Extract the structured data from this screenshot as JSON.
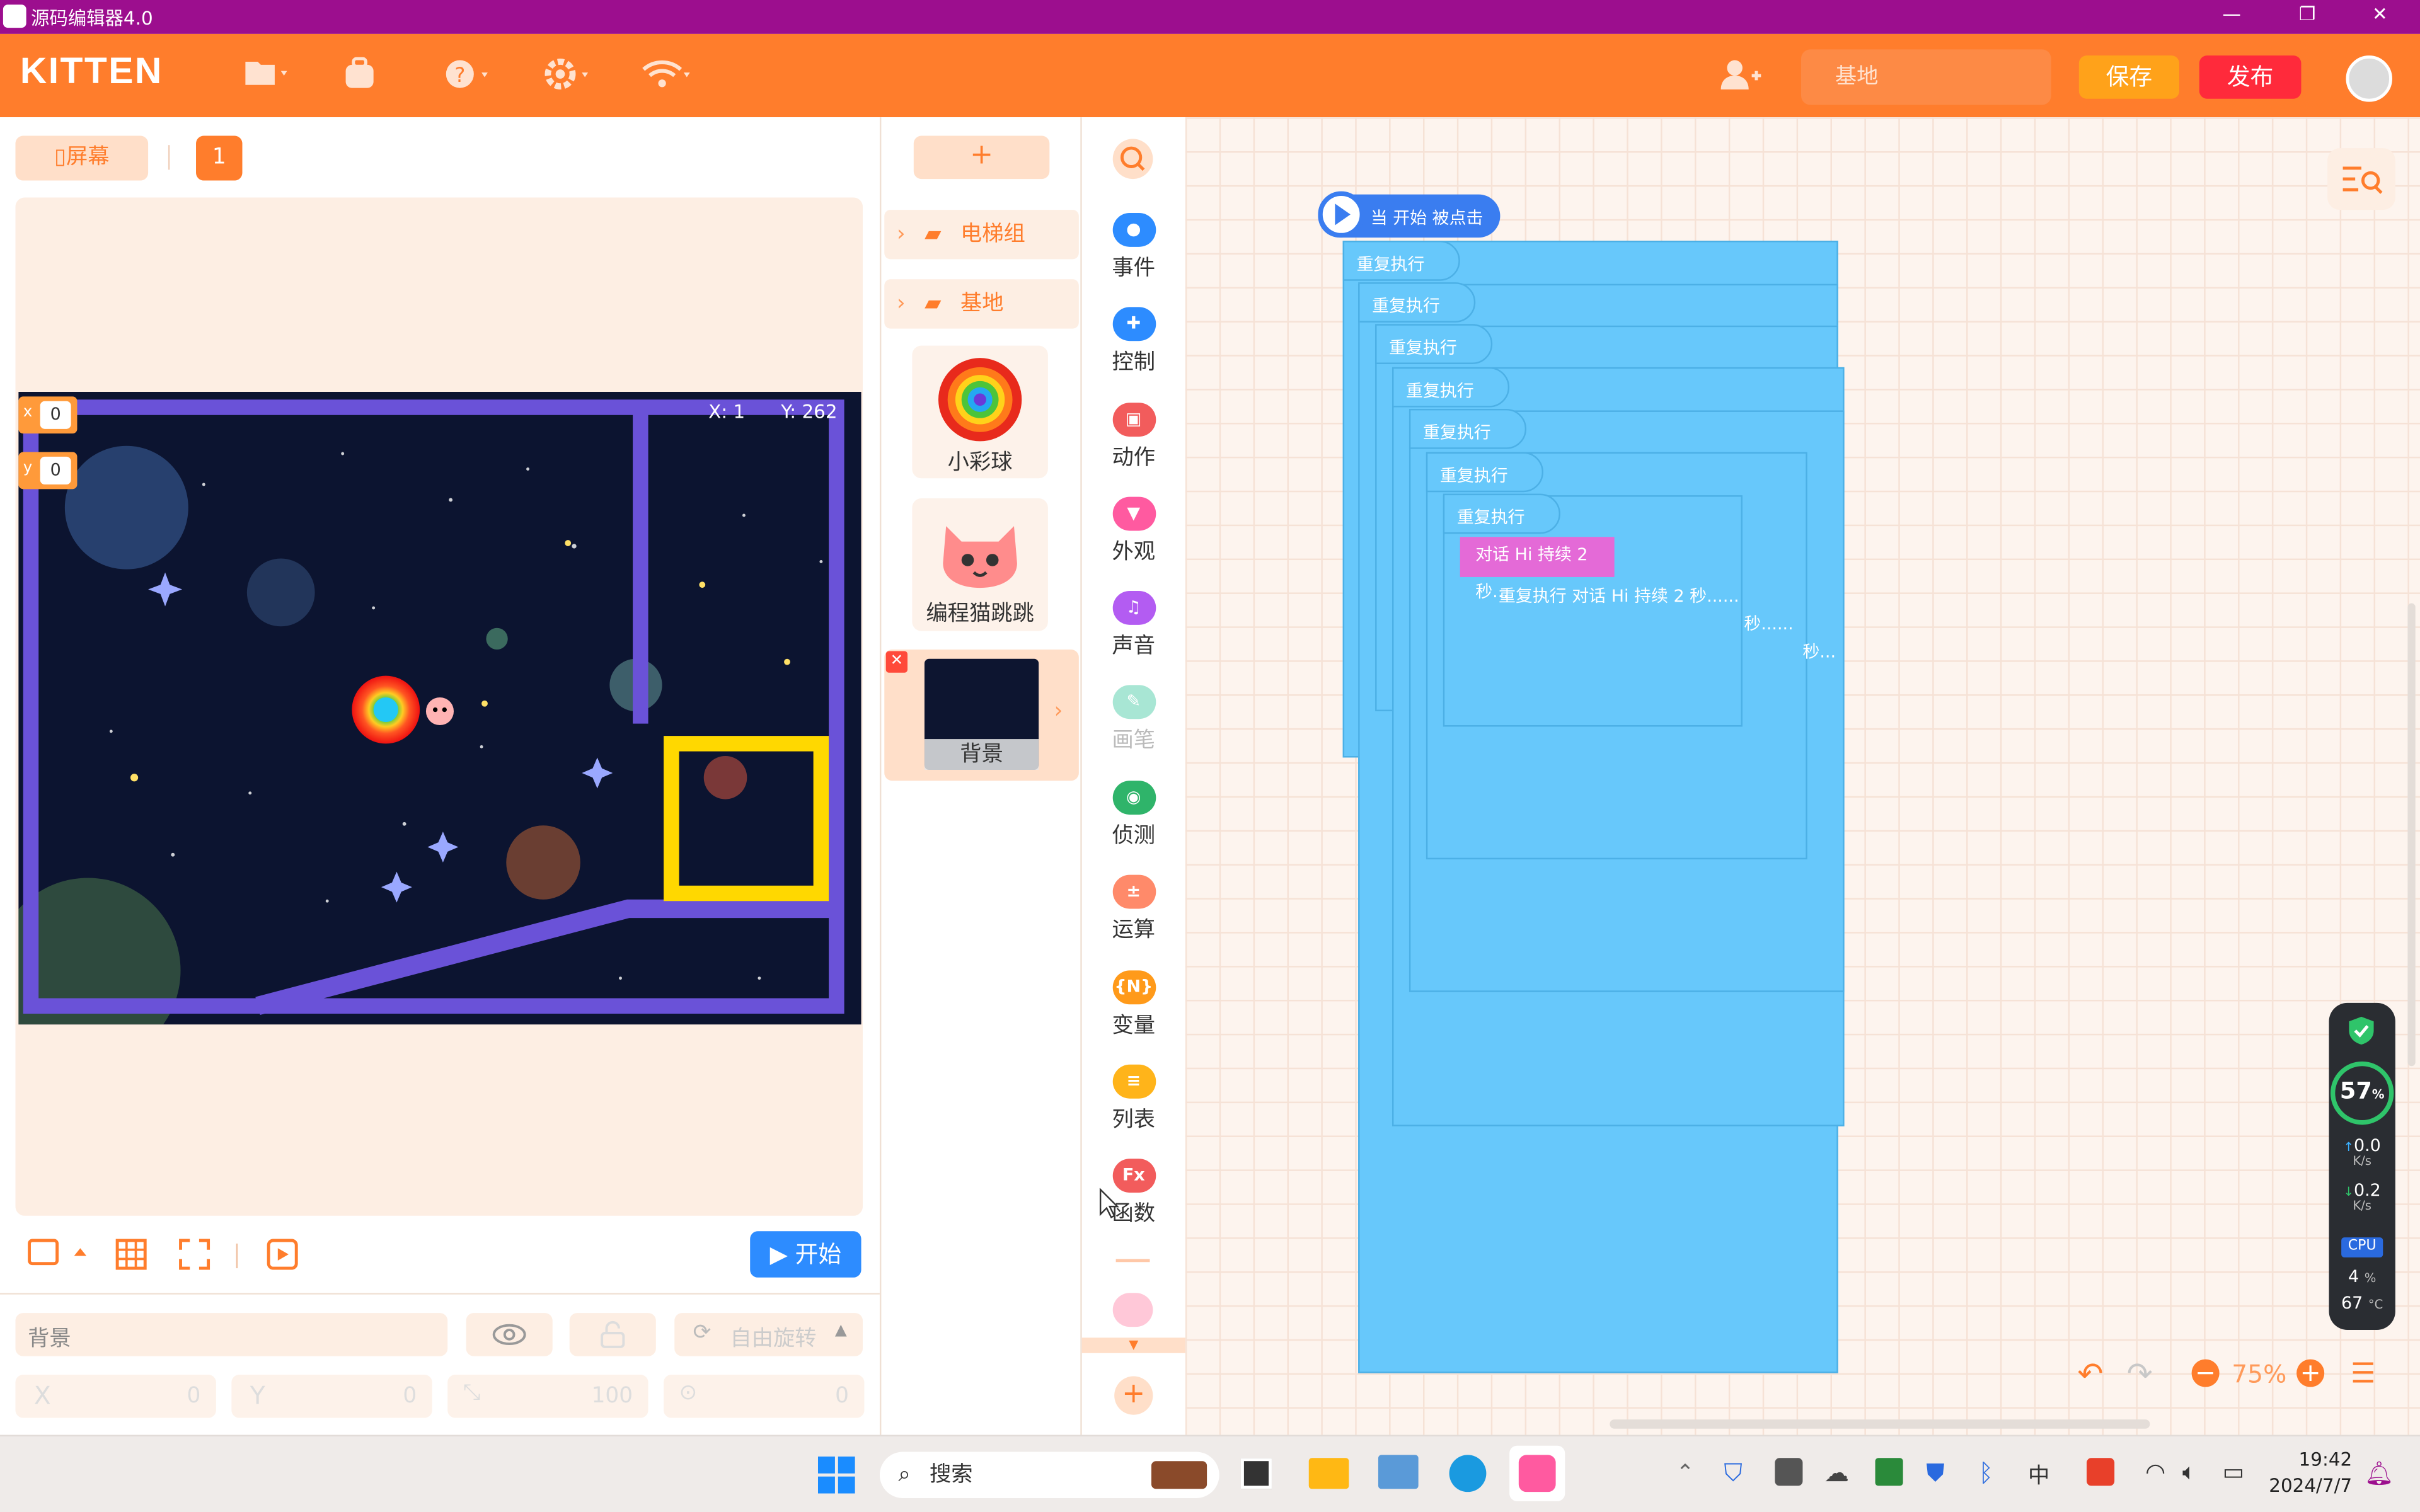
{
  "window": {
    "title": "源码编辑器4.0",
    "minimize": "—",
    "restore": "❐",
    "close": "✕"
  },
  "header": {
    "logo": "KITTEN",
    "search_value": "基地",
    "save_label": "保存",
    "publish_label": "发布",
    "icons": [
      "folder-icon",
      "backpack-icon",
      "help-icon",
      "settings-icon",
      "wifi-icon",
      "add-user-icon",
      "avatar"
    ]
  },
  "stage": {
    "tab_screen": "屏幕",
    "tab_number": "1",
    "x_label": "x",
    "x_value": "0",
    "y_label": "y",
    "y_value": "0",
    "mouse_x": "X: 1",
    "mouse_y": "Y: 262",
    "start_label": "开始",
    "selected_name": "背景",
    "rotation_label": "自由旋转",
    "field_x_label": "X",
    "field_x": "0",
    "field_y_label": "Y",
    "field_y": "0",
    "field_size": "100",
    "field_dir": "0"
  },
  "sprites": {
    "add_label": "+",
    "groups": [
      {
        "label": "电梯组"
      },
      {
        "label": "基地"
      }
    ],
    "items": [
      {
        "name": "小彩球"
      },
      {
        "name": "编程猫跳跳"
      },
      {
        "name": "背景"
      }
    ]
  },
  "categories": [
    {
      "label": "事件",
      "color": "#2d8cff",
      "icon": "event-icon"
    },
    {
      "label": "控制",
      "color": "#2d8cff",
      "icon": "control-icon"
    },
    {
      "label": "动作",
      "color": "#f25c5c",
      "icon": "motion-icon"
    },
    {
      "label": "外观",
      "color": "#ff5aa0",
      "icon": "looks-icon"
    },
    {
      "label": "声音",
      "color": "#b35cf2",
      "icon": "sound-icon"
    },
    {
      "label": "画笔",
      "color": "#a8e6d4",
      "icon": "pen-icon"
    },
    {
      "label": "侦测",
      "color": "#2fb46a",
      "icon": "sensing-icon"
    },
    {
      "label": "运算",
      "color": "#ff8a6a",
      "icon": "operator-icon"
    },
    {
      "label": "变量",
      "color": "#ff9a1a",
      "icon": "variable-icon"
    },
    {
      "label": "列表",
      "color": "#ffb41a",
      "icon": "list-icon"
    },
    {
      "label": "函数",
      "color": "#f25c5c",
      "icon": "function-icon"
    }
  ],
  "code": {
    "hat": "当 开始 被点击",
    "repeat_label": "重复执行",
    "speech": "对话 Hi 持续 2 秒...",
    "overlap_line": "重复执行 对话 Hi 持续 2 秒......",
    "frag1": "秒......",
    "frag2": "秒..."
  },
  "workspace": {
    "zoom": "75%"
  },
  "taskbar": {
    "search_placeholder": "搜索",
    "time": "19:42",
    "date": "2024/7/7",
    "ime": "中"
  },
  "perf": {
    "battery_percent": "57",
    "percent_unit": "%",
    "up_speed": "0.0",
    "down_speed": "0.2",
    "speed_unit": "K/s",
    "cpu_label": "CPU",
    "cpu_value": "4",
    "temp_value": "67",
    "temp_unit": "°C"
  }
}
